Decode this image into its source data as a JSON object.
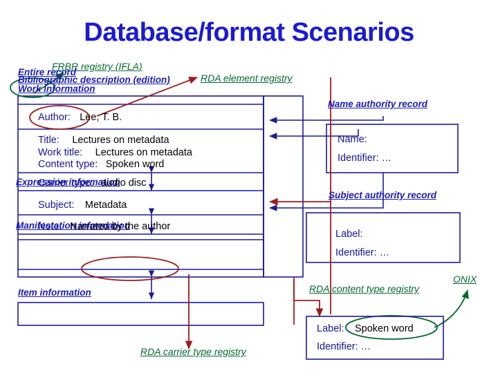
{
  "slide": {
    "title": "Database/format Scenarios"
  },
  "colors": {
    "title_blue": "#1a1ad6",
    "label_blue": "#14149c",
    "section_blue": "#1b1bb5",
    "registry_green": "#00682e",
    "annotation_red": "#9e1b1b",
    "value_black": "#000000",
    "box_blue": "#1a1a99"
  },
  "registries": {
    "frbr": "FRBR registry (IFLA)",
    "rda_element": "RDA element registry",
    "rda_content_type": "RDA carrier type registry",
    "rda_carrier_type": "RDA content type registry",
    "onix": "ONIX"
  },
  "record": {
    "sections": [
      {
        "id": "entire-record",
        "label": "Entire record"
      },
      {
        "id": "bibliographic-description",
        "label": "Bibliographic description (edition)"
      },
      {
        "id": "work-information",
        "label": "Work information"
      },
      {
        "id": "expression-information",
        "label": "Expression information"
      },
      {
        "id": "manifestation-information",
        "label": "Manifestation information"
      },
      {
        "id": "item-information",
        "label": "Item information"
      }
    ],
    "fields": [
      {
        "id": "author",
        "label": "Author:",
        "value": "Lee, T. B."
      },
      {
        "id": "title",
        "label": "Title:",
        "value": "Lectures on metadata"
      },
      {
        "id": "work-title",
        "label": "Work title:",
        "value": "Lectures on metadata"
      },
      {
        "id": "content-type",
        "label": "Content type:",
        "value": "Spoken word"
      },
      {
        "id": "carrier-type",
        "label": "Carrier type:",
        "value": "audio disc"
      },
      {
        "id": "subject",
        "label": "Subject:",
        "value": "Metadata"
      },
      {
        "id": "note",
        "label": "Note:",
        "value": "Narrated by the author"
      }
    ]
  },
  "authority_records": [
    {
      "id": "name-authority-record",
      "heading": "Name authority record",
      "rows": [
        {
          "label": "Name:",
          "value": ""
        },
        {
          "label": "Identifier: …",
          "value": ""
        }
      ]
    },
    {
      "id": "subject-authority-record",
      "heading": "Subject authority record",
      "rows": [
        {
          "label": "Label:",
          "value": ""
        },
        {
          "label": "Identifier: …",
          "value": ""
        }
      ]
    },
    {
      "id": "content-type-registry-record",
      "heading": "RDA content type registry",
      "rows": [
        {
          "label": "Label:",
          "value": "Spoken word"
        },
        {
          "label": "Identifier: …",
          "value": ""
        }
      ]
    }
  ]
}
